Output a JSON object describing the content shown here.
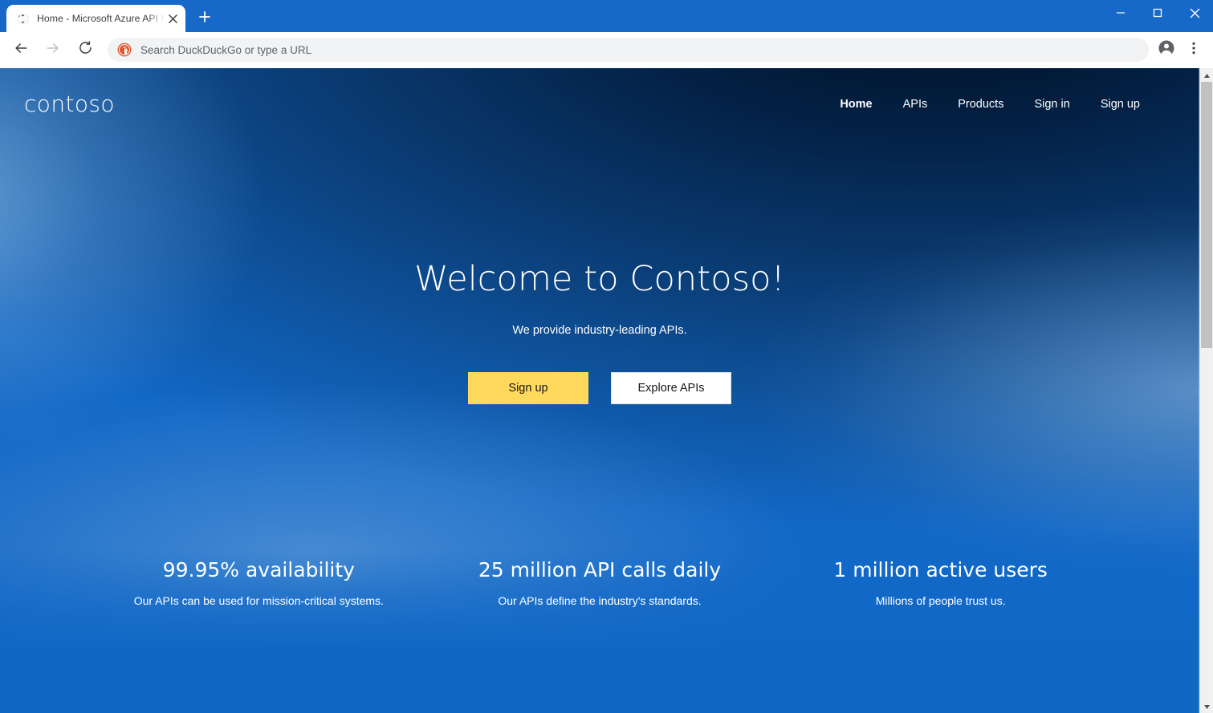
{
  "browser": {
    "tab": {
      "title": "Home - Microsoft Azure API Man",
      "favicon_icon": "globe-icon",
      "close_icon": "close-icon"
    },
    "new_tab_icon": "plus-icon",
    "window_controls": {
      "minimize_icon": "minimize-icon",
      "maximize_icon": "maximize-icon",
      "close_icon": "close-icon"
    },
    "toolbar": {
      "back_icon": "back-arrow-icon",
      "forward_icon": "forward-arrow-icon",
      "reload_icon": "reload-icon",
      "profile_icon": "account-avatar-icon",
      "menu_icon": "three-dot-menu-icon"
    },
    "omnibox": {
      "search_engine_icon": "duckduckgo-icon",
      "value": "",
      "placeholder": "Search DuckDuckGo or type a URL"
    },
    "scrollbar": {
      "up_arrow_icon": "scroll-up-arrow-icon",
      "down_arrow_icon": "scroll-down-arrow-icon",
      "thumb_position": "top"
    },
    "colors": {
      "chrome_blue": "#1668c9",
      "toolbar_white": "#ffffff",
      "omnibox_grey": "#f1f3f4"
    }
  },
  "site": {
    "brand": "contoso",
    "nav": [
      {
        "label": "Home",
        "active": true
      },
      {
        "label": "APIs",
        "active": false
      },
      {
        "label": "Products",
        "active": false
      },
      {
        "label": "Sign in",
        "active": false
      },
      {
        "label": "Sign up",
        "active": false
      }
    ],
    "hero": {
      "title": "Welcome to Contoso!",
      "subtitle": "We provide industry-leading APIs.",
      "primary_button": "Sign up",
      "secondary_button": "Explore APIs"
    },
    "stats": [
      {
        "value": "99.95% availability",
        "description": "Our APIs can be used for mission-critical systems."
      },
      {
        "value": "25 million API calls daily",
        "description": "Our APIs define the industry's standards."
      },
      {
        "value": "1 million active users",
        "description": "Millions of people trust us."
      }
    ],
    "colors": {
      "accent_yellow": "#ffd95b",
      "hero_blue": "#1268c6",
      "hero_navy": "#001020",
      "text_white": "#ffffff"
    }
  }
}
